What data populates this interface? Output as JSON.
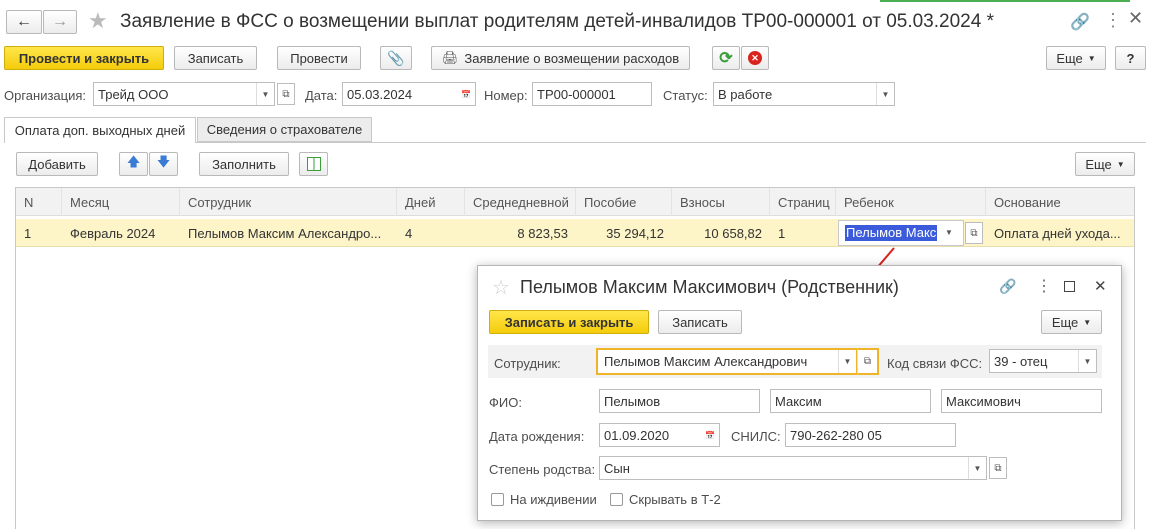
{
  "window": {
    "title": "Заявление в ФСС о возмещении выплат родителям детей-инвалидов ТР00-000001 от 05.03.2024 *"
  },
  "toolbar": {
    "post_close": "Провести и закрыть",
    "save": "Записать",
    "post": "Провести",
    "expense_claim": "Заявление о возмещении расходов",
    "more": "Еще",
    "help": "?"
  },
  "header": {
    "org_label": "Организация:",
    "org_value": "Трейд ООО",
    "date_label": "Дата:",
    "date_value": "05.03.2024",
    "number_label": "Номер:",
    "number_value": "ТР00-000001",
    "status_label": "Статус:",
    "status_value": "В работе"
  },
  "tabs": [
    {
      "label": "Оплата доп. выходных дней"
    },
    {
      "label": "Сведения о страхователе"
    }
  ],
  "table_toolbar": {
    "add": "Добавить",
    "fill": "Заполнить",
    "more": "Еще"
  },
  "table": {
    "columns": [
      "N",
      "Месяц",
      "Сотрудник",
      "Дней",
      "Среднедневной",
      "Пособие",
      "Взносы",
      "Страниц",
      "Ребенок",
      "Основание"
    ],
    "rows": [
      {
        "n": "1",
        "month": "Февраль 2024",
        "employee": "Пелымов Максим Александро...",
        "days": "4",
        "avg": "8 823,53",
        "benefit": "35 294,12",
        "contrib": "10 658,82",
        "pages": "1",
        "child": "Пелымов Макс",
        "basis": "Оплата дней ухода..."
      }
    ]
  },
  "dialog": {
    "title": "Пелымов Максим Максимович (Родственник)",
    "save_close": "Записать и закрыть",
    "save": "Записать",
    "more": "Еще",
    "employee_label": "Сотрудник:",
    "employee_value": "Пелымов Максим Александрович",
    "relation_label": "Код связи ФСС:",
    "relation_value": "39 - отец",
    "fio_label": "ФИО:",
    "last_name": "Пелымов",
    "first_name": "Максим",
    "middle_name": "Максимович",
    "birth_label": "Дата рождения:",
    "birth_value": "01.09.2020",
    "snils_label": "СНИЛС:",
    "snils_value": "790-262-280 05",
    "kinship_label": "Степень родства:",
    "kinship_value": "Сын",
    "dependent_label": "На иждивении",
    "hide_label": "Скрывать в Т-2"
  },
  "colors": {
    "accent_yellow": "#f5cc0b",
    "selected_row": "#fdf4c8",
    "highlight": "#3b5bdb",
    "focus_border": "#f0b428",
    "arrow": "#d9231d"
  }
}
